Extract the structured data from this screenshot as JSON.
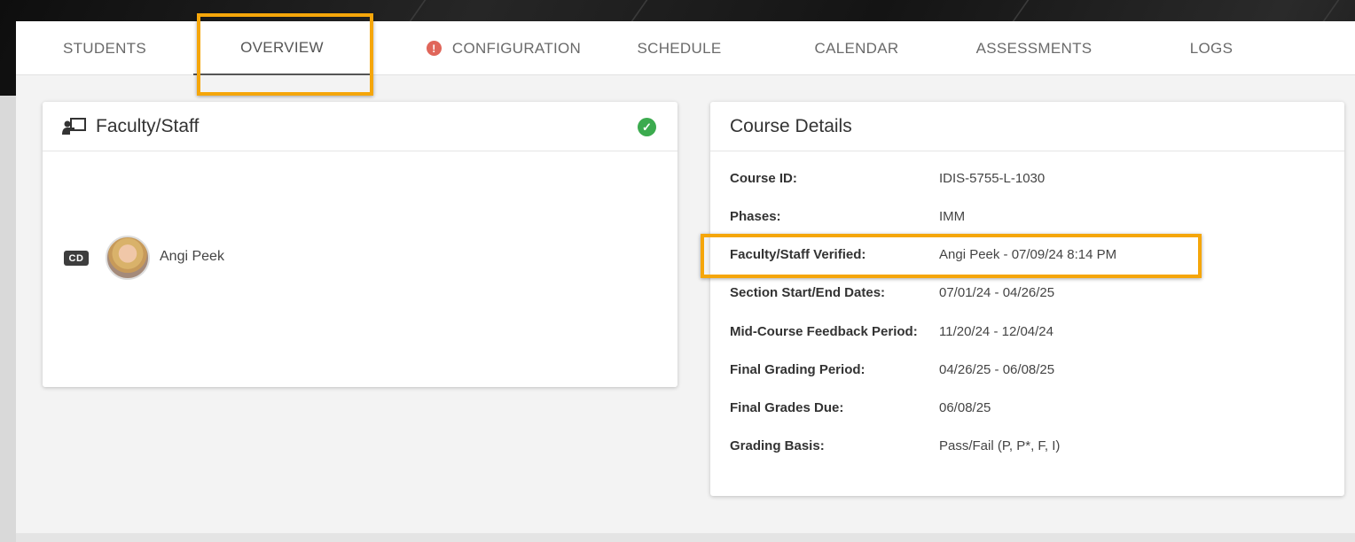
{
  "tabs": [
    {
      "label": "STUDENTS"
    },
    {
      "label": "OVERVIEW",
      "active": true
    },
    {
      "label": "CONFIGURATION",
      "warning": true
    },
    {
      "label": "SCHEDULE"
    },
    {
      "label": "CALENDAR"
    },
    {
      "label": "ASSESSMENTS"
    },
    {
      "label": "LOGS"
    }
  ],
  "warning_icon_glyph": "!",
  "faculty_card": {
    "title": "Faculty/Staff",
    "title_icon": "presenter-icon",
    "status_icon": "check-circle-icon",
    "status_color": "#3cab4f",
    "members": [
      {
        "role": "CD",
        "name": "Angi Peek"
      }
    ]
  },
  "course_card": {
    "title": "Course Details",
    "rows": [
      {
        "label": "Course ID:",
        "value": "IDIS-5755-L-1030"
      },
      {
        "label": "Phases:",
        "value": "IMM"
      },
      {
        "label": "Faculty/Staff Verified:",
        "value": "Angi Peek - 07/09/24 8:14 PM"
      },
      {
        "label": "Section Start/End Dates:",
        "value": "07/01/24 - 04/26/25"
      },
      {
        "label": "Mid-Course Feedback Period:",
        "value": "11/20/24 - 12/04/24"
      },
      {
        "label": "Final Grading Period:",
        "value": "04/26/25 - 06/08/25"
      },
      {
        "label": "Final Grades Due:",
        "value": "06/08/25"
      },
      {
        "label": "Grading Basis:",
        "value": "Pass/Fail (P, P*, F, I)"
      }
    ]
  },
  "colors": {
    "highlight": "#f5a60a",
    "warning": "#e0665a"
  }
}
